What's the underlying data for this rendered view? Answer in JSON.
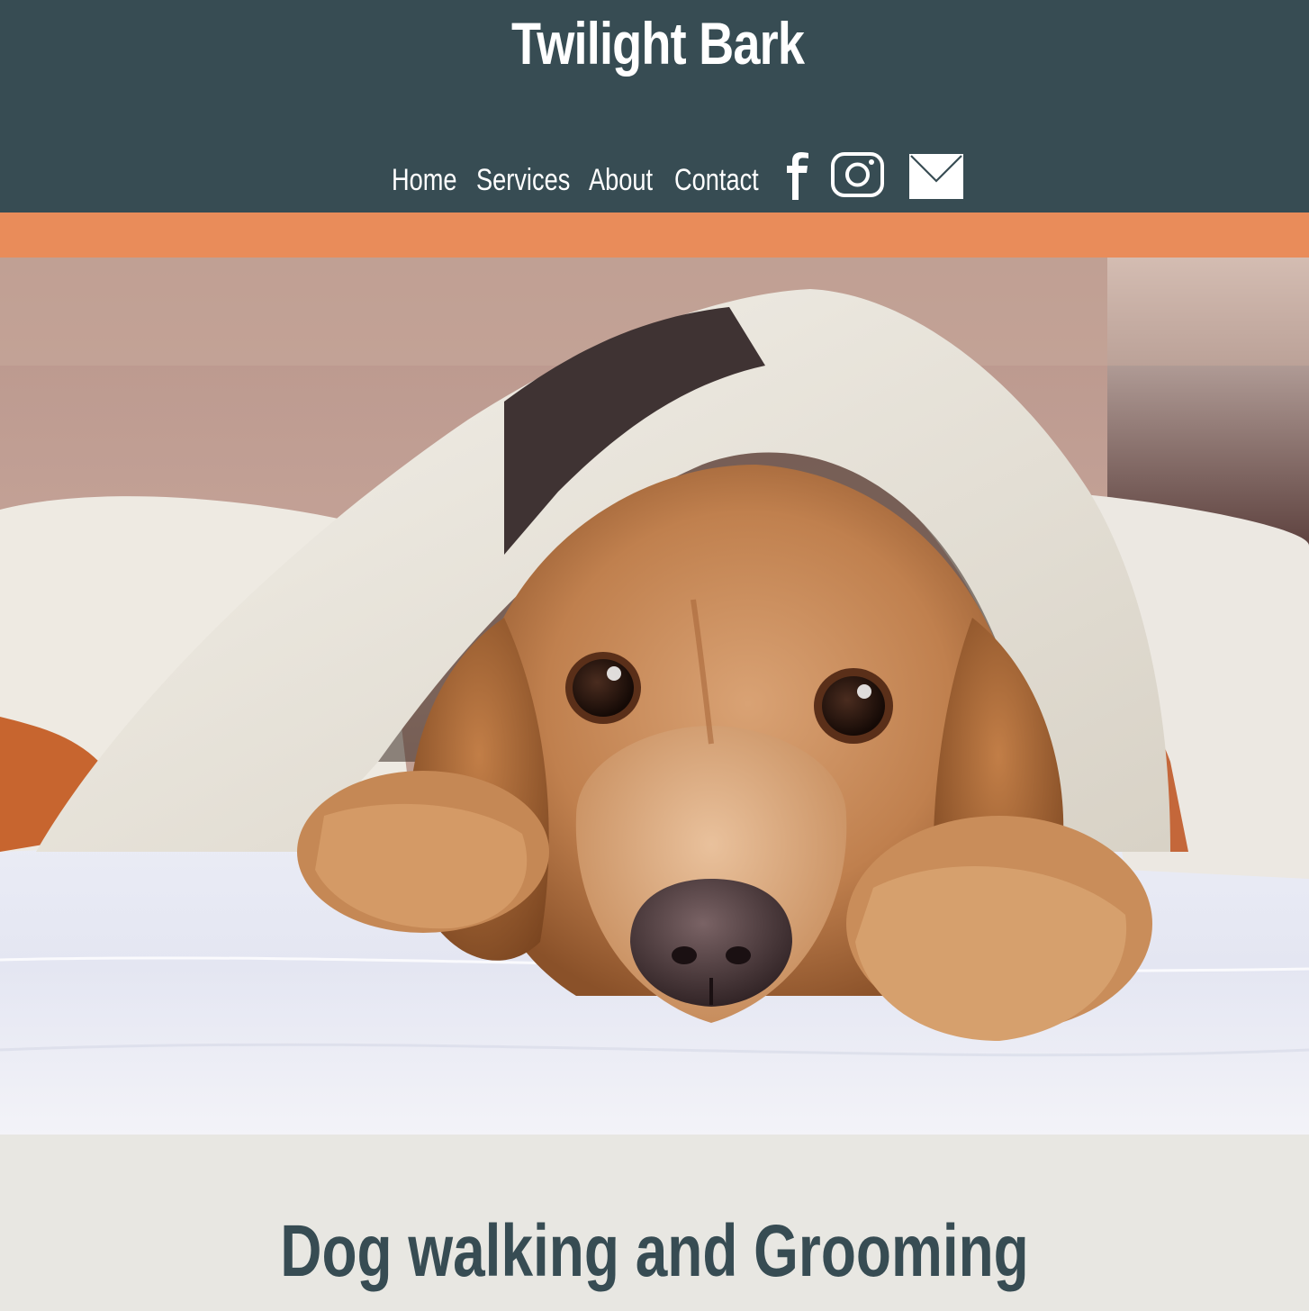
{
  "site": {
    "title": "Twilight Bark"
  },
  "nav": {
    "items": [
      {
        "label": "Home"
      },
      {
        "label": "Services"
      },
      {
        "label": "About"
      },
      {
        "label": "Contact"
      }
    ],
    "social": [
      {
        "icon": "facebook-icon"
      },
      {
        "icon": "instagram-icon"
      },
      {
        "icon": "mail-icon"
      }
    ]
  },
  "hero": {
    "image": "photo-of-golden-cocker-spaniel-under-blanket"
  },
  "main": {
    "heading": "Dog walking and Grooming"
  },
  "colors": {
    "header_bg": "#374c53",
    "accent_stripe": "#e98c5a",
    "page_bg": "#e8e7e2",
    "heading_text": "#374c53"
  }
}
